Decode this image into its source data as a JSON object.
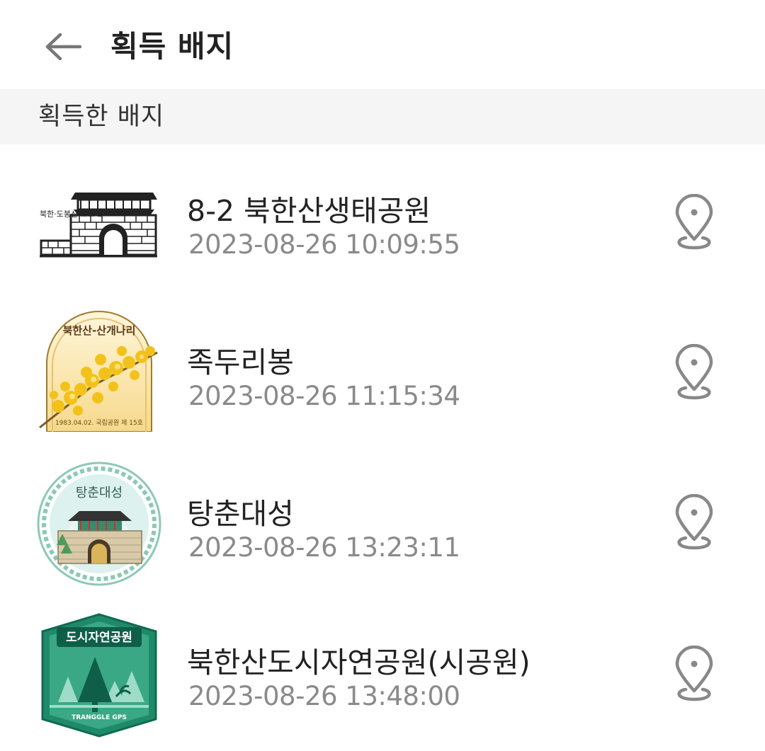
{
  "header": {
    "title": "획득 배지",
    "back_icon": "arrow-left-icon"
  },
  "section": {
    "title": "획득한 배지"
  },
  "badges": [
    {
      "name": "8-2 북한산생태공원",
      "date": "2023-08-26 10:09:55",
      "badge_text": "북한·도봉산 코스 2",
      "location_icon": "map-pin-icon"
    },
    {
      "name": "족두리봉",
      "date": "2023-08-26 11:15:34",
      "badge_text": "북한산-산개나리",
      "badge_subtext": "1983.04.02. 국립공원 제 15호",
      "location_icon": "map-pin-icon"
    },
    {
      "name": "탕춘대성",
      "date": "2023-08-26 13:23:11",
      "badge_text": "탕춘대성",
      "location_icon": "map-pin-icon"
    },
    {
      "name": "북한산도시자연공원(시공원)",
      "date": "2023-08-26 13:48:00",
      "badge_text": "도시자연공원",
      "badge_subtext": "TRANGGLE GPS",
      "location_icon": "map-pin-icon"
    }
  ],
  "colors": {
    "title": "#222222",
    "date": "#8a8a8a",
    "section_bg": "#f5f5f5",
    "icon": "#888888"
  }
}
